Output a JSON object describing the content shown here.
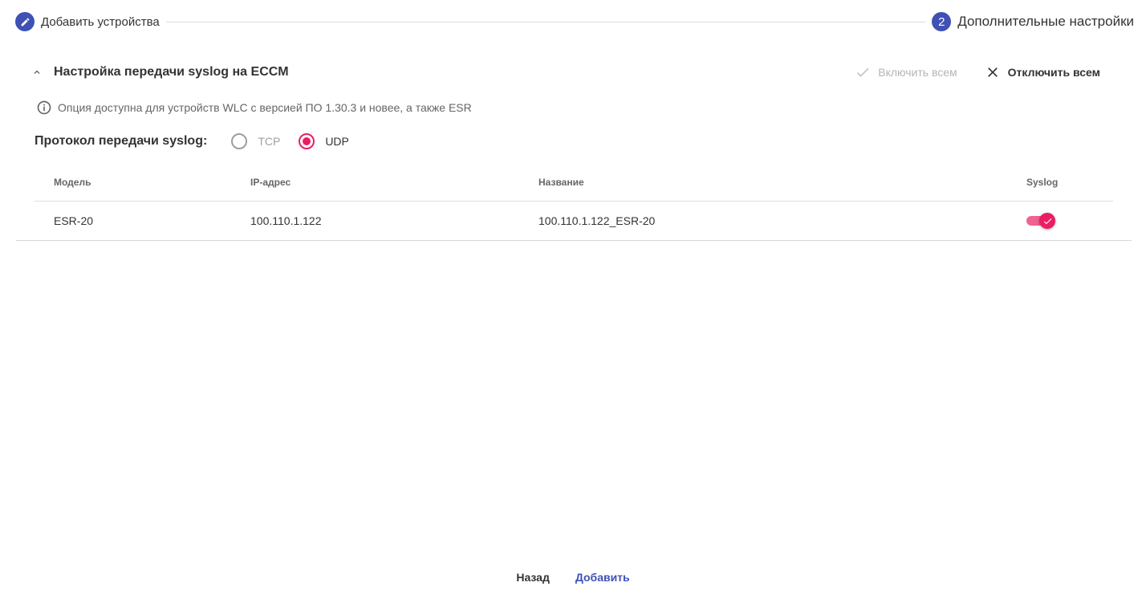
{
  "stepper": {
    "step1": {
      "label": "Добавить устройства",
      "icon": "pencil-icon"
    },
    "step2": {
      "number": "2",
      "label": "Дополнительные настройки"
    }
  },
  "section": {
    "title": "Настройка передачи syslog на ECCM",
    "enable_all_label": "Включить всем",
    "disable_all_label": "Отключить всем"
  },
  "info": {
    "text": "Опция доступна для устройств WLC с версией ПО 1.30.3 и новее, а также ESR"
  },
  "protocol": {
    "label": "Протокол передачи syslog:",
    "options": [
      {
        "label": "TCP",
        "selected": false
      },
      {
        "label": "UDP",
        "selected": true
      }
    ]
  },
  "table": {
    "headers": {
      "model": "Модель",
      "ip": "IP-адрес",
      "name": "Название",
      "syslog": "Syslog"
    },
    "rows": [
      {
        "model": "ESR-20",
        "ip": "100.110.1.122",
        "name": "100.110.1.122_ESR-20",
        "syslog": true
      }
    ]
  },
  "footer": {
    "back_label": "Назад",
    "add_label": "Добавить"
  },
  "colors": {
    "primary": "#3f51b5",
    "accent": "#e91e63",
    "accent_light": "#f06292",
    "disabled": "#b5b5b5"
  }
}
